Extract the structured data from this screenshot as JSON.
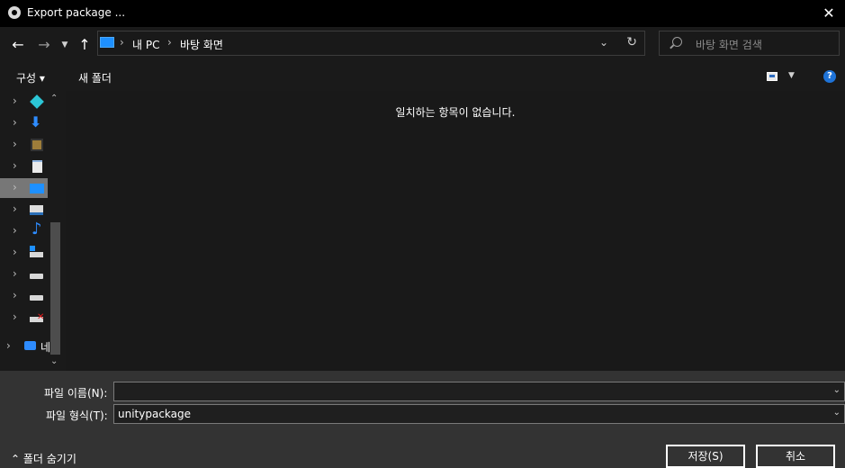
{
  "window": {
    "title": "Export package ...",
    "close_glyph": "✕"
  },
  "nav": {
    "back_glyph": "←",
    "forward_glyph": "→",
    "history_glyph": "▼",
    "up_glyph": "↑",
    "breadcrumbs": [
      "내 PC",
      "바탕 화면"
    ],
    "crumb_separator": "›",
    "address_dropdown_glyph": "⌄",
    "refresh_glyph": "↻",
    "search_placeholder": "바탕 화면 검색"
  },
  "toolbar": {
    "organize_label": "구성 ▾",
    "new_folder_label": "새 폴더",
    "view_dropdown_glyph": "▼",
    "help_glyph": "?"
  },
  "sidebar": {
    "scroll_up_glyph": "⌃",
    "scroll_down_glyph": "⌄",
    "expand_glyph": "›",
    "items": [
      {
        "icon": "3d-objects-icon"
      },
      {
        "icon": "downloads-icon"
      },
      {
        "icon": "videos-icon"
      },
      {
        "icon": "documents-icon"
      },
      {
        "icon": "desktop-icon",
        "selected": true
      },
      {
        "icon": "pictures-icon"
      },
      {
        "icon": "music-icon"
      },
      {
        "icon": "windows-drive-icon"
      },
      {
        "icon": "drive-icon"
      },
      {
        "icon": "drive-icon"
      },
      {
        "icon": "disconnected-drive-icon"
      },
      {
        "icon": "network-icon",
        "label": "네"
      }
    ]
  },
  "content": {
    "empty_message": "일치하는 항목이 없습니다."
  },
  "form": {
    "filename_label": "파일 이름(N):",
    "filename_value": "",
    "filetype_label": "파일 형식(T):",
    "filetype_value": "unitypackage",
    "caret_glyph": "⌄"
  },
  "footer": {
    "hide_folders_label": "⌃  폴더 숨기기",
    "save_label": "저장(S)",
    "cancel_label": "취소"
  }
}
